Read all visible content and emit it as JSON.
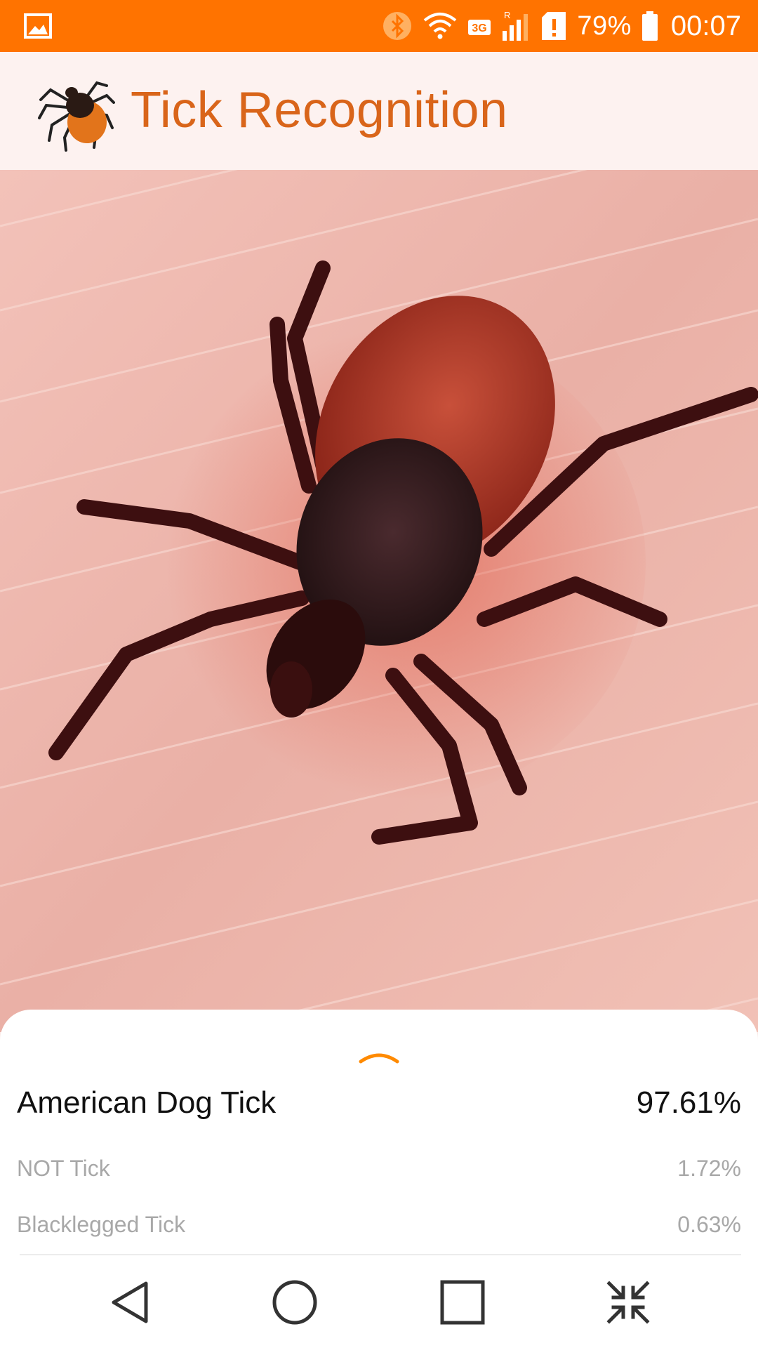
{
  "status_bar": {
    "battery_percent": "79%",
    "time": "00:07",
    "network_label": "3G",
    "roaming_label": "R",
    "icons": [
      "gallery-icon",
      "bluetooth-icon",
      "wifi-icon",
      "signal-icon",
      "sd-card-alert-icon",
      "battery-icon"
    ]
  },
  "header": {
    "title": "Tick Recognition",
    "logo_icon": "tick-logo-icon",
    "title_color": "#d9651a"
  },
  "photo": {
    "alt": "tick on skin photo"
  },
  "results": {
    "top": {
      "label": "American Dog Tick",
      "value": "97.61%"
    },
    "items": [
      {
        "label": "NOT Tick",
        "value": "1.72%"
      },
      {
        "label": "Blacklegged Tick",
        "value": "0.63%"
      }
    ]
  },
  "nav_bar": {
    "icons": [
      "back-icon",
      "home-icon",
      "recents-icon",
      "collapse-icon"
    ]
  },
  "colors": {
    "status_bar": "#ff7300",
    "accent": "#ff8a00"
  }
}
